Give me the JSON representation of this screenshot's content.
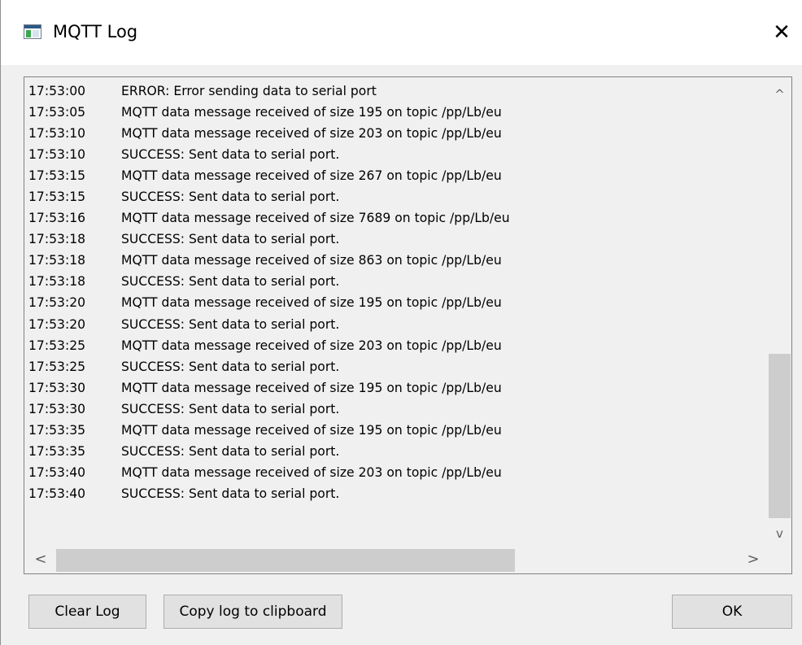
{
  "window": {
    "title": "MQTT Log",
    "icon": "window-app-icon",
    "close_label": "✕"
  },
  "log": {
    "lines": [
      {
        "time": "17:53:00",
        "message": "ERROR: Error sending data to serial port"
      },
      {
        "time": "17:53:05",
        "message": "MQTT data message received of size 195 on topic /pp/Lb/eu"
      },
      {
        "time": "17:53:10",
        "message": "MQTT data message received of size 203 on topic /pp/Lb/eu"
      },
      {
        "time": "17:53:10",
        "message": "SUCCESS: Sent data to serial port."
      },
      {
        "time": "17:53:15",
        "message": "MQTT data message received of size 267 on topic /pp/Lb/eu"
      },
      {
        "time": "17:53:15",
        "message": "SUCCESS: Sent data to serial port."
      },
      {
        "time": "17:53:16",
        "message": "MQTT data message received of size 7689 on topic /pp/Lb/eu"
      },
      {
        "time": "17:53:18",
        "message": "SUCCESS: Sent data to serial port."
      },
      {
        "time": "17:53:18",
        "message": "MQTT data message received of size 863 on topic /pp/Lb/eu"
      },
      {
        "time": "17:53:18",
        "message": "SUCCESS: Sent data to serial port."
      },
      {
        "time": "17:53:20",
        "message": "MQTT data message received of size 195 on topic /pp/Lb/eu"
      },
      {
        "time": "17:53:20",
        "message": "SUCCESS: Sent data to serial port."
      },
      {
        "time": "17:53:25",
        "message": "MQTT data message received of size 203 on topic /pp/Lb/eu"
      },
      {
        "time": "17:53:25",
        "message": "SUCCESS: Sent data to serial port."
      },
      {
        "time": "17:53:30",
        "message": "MQTT data message received of size 195 on topic /pp/Lb/eu"
      },
      {
        "time": "17:53:30",
        "message": "SUCCESS: Sent data to serial port."
      },
      {
        "time": "17:53:35",
        "message": "MQTT data message received of size 195 on topic /pp/Lb/eu"
      },
      {
        "time": "17:53:35",
        "message": "SUCCESS: Sent data to serial port."
      },
      {
        "time": "17:53:40",
        "message": "MQTT data message received of size 203 on topic /pp/Lb/eu"
      },
      {
        "time": "17:53:40",
        "message": "SUCCESS: Sent data to serial port."
      }
    ],
    "scrollbar": {
      "up_arrow": "^",
      "down_arrow": "v",
      "left_arrow": "<",
      "right_arrow": ">"
    }
  },
  "buttons": {
    "clear_label": "Clear Log",
    "copy_label": "Copy log to clipboard",
    "ok_label": "OK"
  },
  "colors": {
    "background": "#f0f0f0",
    "titlebar": "#ffffff",
    "button_face": "#e1e1e1",
    "scroll_thumb": "#cdcdcd"
  }
}
